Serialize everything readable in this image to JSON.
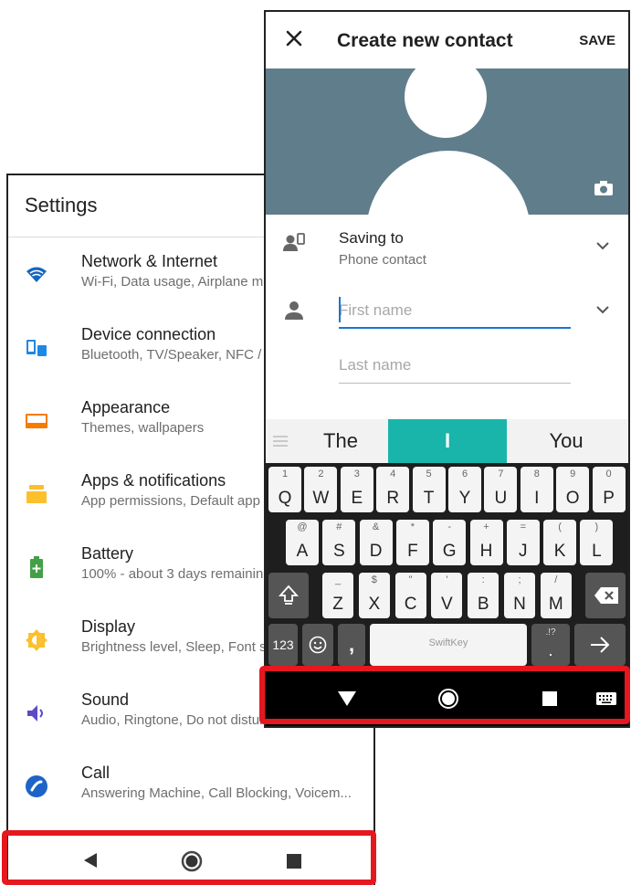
{
  "settings": {
    "title": "Settings",
    "items": [
      {
        "icon": "wifi-icon",
        "title": "Network & Internet",
        "subtitle": "Wi-Fi, Data usage, Airplane m",
        "color": "#1565c0"
      },
      {
        "icon": "device-connection-icon",
        "title": "Device connection",
        "subtitle": "Bluetooth, TV/Speaker, NFC /",
        "color": "#1e88e5"
      },
      {
        "icon": "appearance-icon",
        "title": "Appearance",
        "subtitle": "Themes, wallpapers",
        "color": "#f57c00"
      },
      {
        "icon": "apps-icon",
        "title": "Apps & notifications",
        "subtitle": "App permissions, Default app",
        "color": "#fbc02d"
      },
      {
        "icon": "battery-icon",
        "title": "Battery",
        "subtitle": "100% - about 3 days remainin",
        "color": "#43a047"
      },
      {
        "icon": "display-icon",
        "title": "Display",
        "subtitle": "Brightness level, Sleep, Font s",
        "color": "#fbc02d"
      },
      {
        "icon": "sound-icon",
        "title": "Sound",
        "subtitle": "Audio, Ringtone, Do not distur",
        "color": "#5c4bc7"
      },
      {
        "icon": "call-icon",
        "title": "Call",
        "subtitle": "Answering Machine, Call Blocking, Voicem...",
        "color": "#1e63c8"
      }
    ]
  },
  "contact": {
    "close_icon": "close-icon",
    "title": "Create new contact",
    "save_label": "SAVE",
    "photo_color": "#607d8b",
    "saving_to_label": "Saving to",
    "saving_to_value": "Phone contact",
    "first_name_placeholder": "First name",
    "last_name_placeholder": "Last name"
  },
  "keyboard": {
    "suggestions": [
      "The",
      "I",
      "You"
    ],
    "accent": "#19b5aa",
    "row1": [
      [
        "1",
        "Q"
      ],
      [
        "2",
        "W"
      ],
      [
        "3",
        "E"
      ],
      [
        "4",
        "R"
      ],
      [
        "5",
        "T"
      ],
      [
        "6",
        "Y"
      ],
      [
        "7",
        "U"
      ],
      [
        "8",
        "I"
      ],
      [
        "9",
        "O"
      ],
      [
        "0",
        "P"
      ]
    ],
    "row2": [
      [
        "@",
        "A"
      ],
      [
        "#",
        "S"
      ],
      [
        "&",
        "D"
      ],
      [
        "*",
        "F"
      ],
      [
        "-",
        "G"
      ],
      [
        "+",
        "H"
      ],
      [
        "=",
        "J"
      ],
      [
        "(",
        "K"
      ],
      [
        ")",
        "L"
      ]
    ],
    "row3": [
      [
        "_",
        "Z"
      ],
      [
        "$",
        "X"
      ],
      [
        "\"",
        "C"
      ],
      [
        "'",
        "V"
      ],
      [
        ":",
        "B"
      ],
      [
        ";",
        "N"
      ],
      [
        "/",
        "M"
      ]
    ],
    "numbers_label": "123",
    "comma_label": ",",
    "space_brand": "SwiftKey",
    "period_hint": ".!?",
    "period_label": "."
  },
  "navbar": {
    "back_icon": "back-icon",
    "home_icon": "home-icon",
    "recents_icon": "recents-icon",
    "keyboard_icon": "keyboard-icon",
    "highlight_color": "#e5171f"
  }
}
